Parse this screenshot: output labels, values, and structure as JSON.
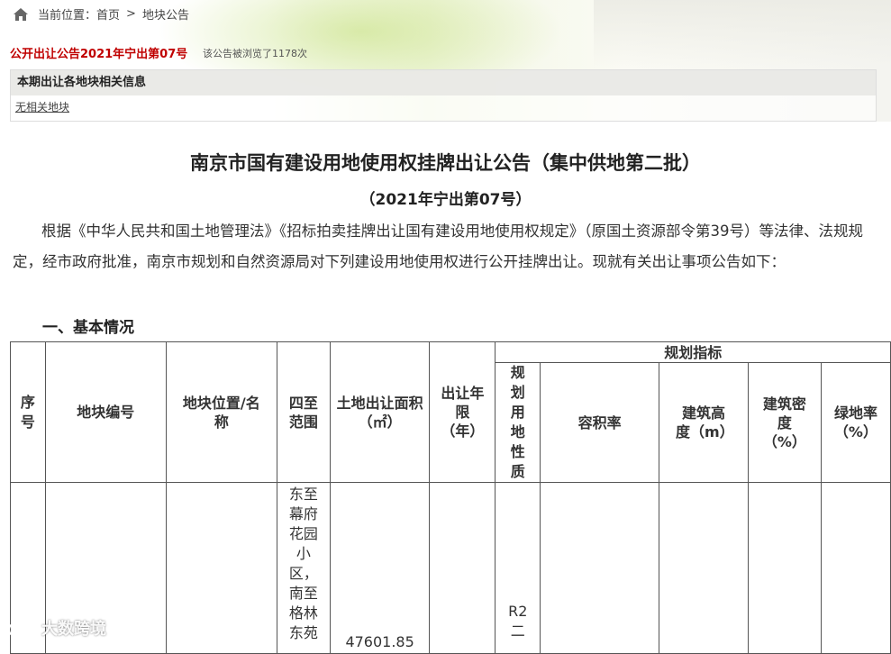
{
  "breadcrumb": {
    "prefix": "当前位置：",
    "home": "首页",
    "separator": ">",
    "current": "地块公告"
  },
  "notice": {
    "title": "公开出让公告2021年宁出第07号",
    "views": "该公告被浏览了1178次"
  },
  "related": {
    "heading": "本期出让各地块相关信息",
    "link": "无相关地块"
  },
  "document": {
    "title": "南京市国有建设用地使用权挂牌出让公告（集中供地第二批）",
    "subtitle": "（2021年宁出第07号）",
    "intro": "根据《中华人民共和国土地管理法》《招标拍卖挂牌出让国有建设用地使用权规定》（原国土资源部令第39号）等法律、法规规定，经市政府批准，南京市规划和自然资源局对下列建设用地使用权进行公开挂牌出让。现就有关出让事项公告如下：",
    "section1": "一、基本情况"
  },
  "table": {
    "headers": {
      "seq": "序号",
      "parcel_no": "地块编号",
      "location": "地块位置/名称",
      "boundaries": "四至范围",
      "area": "土地出让面积（㎡）",
      "term": "出让年限（年）",
      "planning": "规划指标",
      "use": "规划用地性质",
      "far": "容积率",
      "height": "建筑高度（m）",
      "density": "建筑密度（%）",
      "green": "绿地率（%）"
    },
    "row1": {
      "boundaries": "东至幕府花园小区，南至格林东苑",
      "area": "47601.85",
      "use": "R2二"
    }
  },
  "watermark": "大数跨境"
}
